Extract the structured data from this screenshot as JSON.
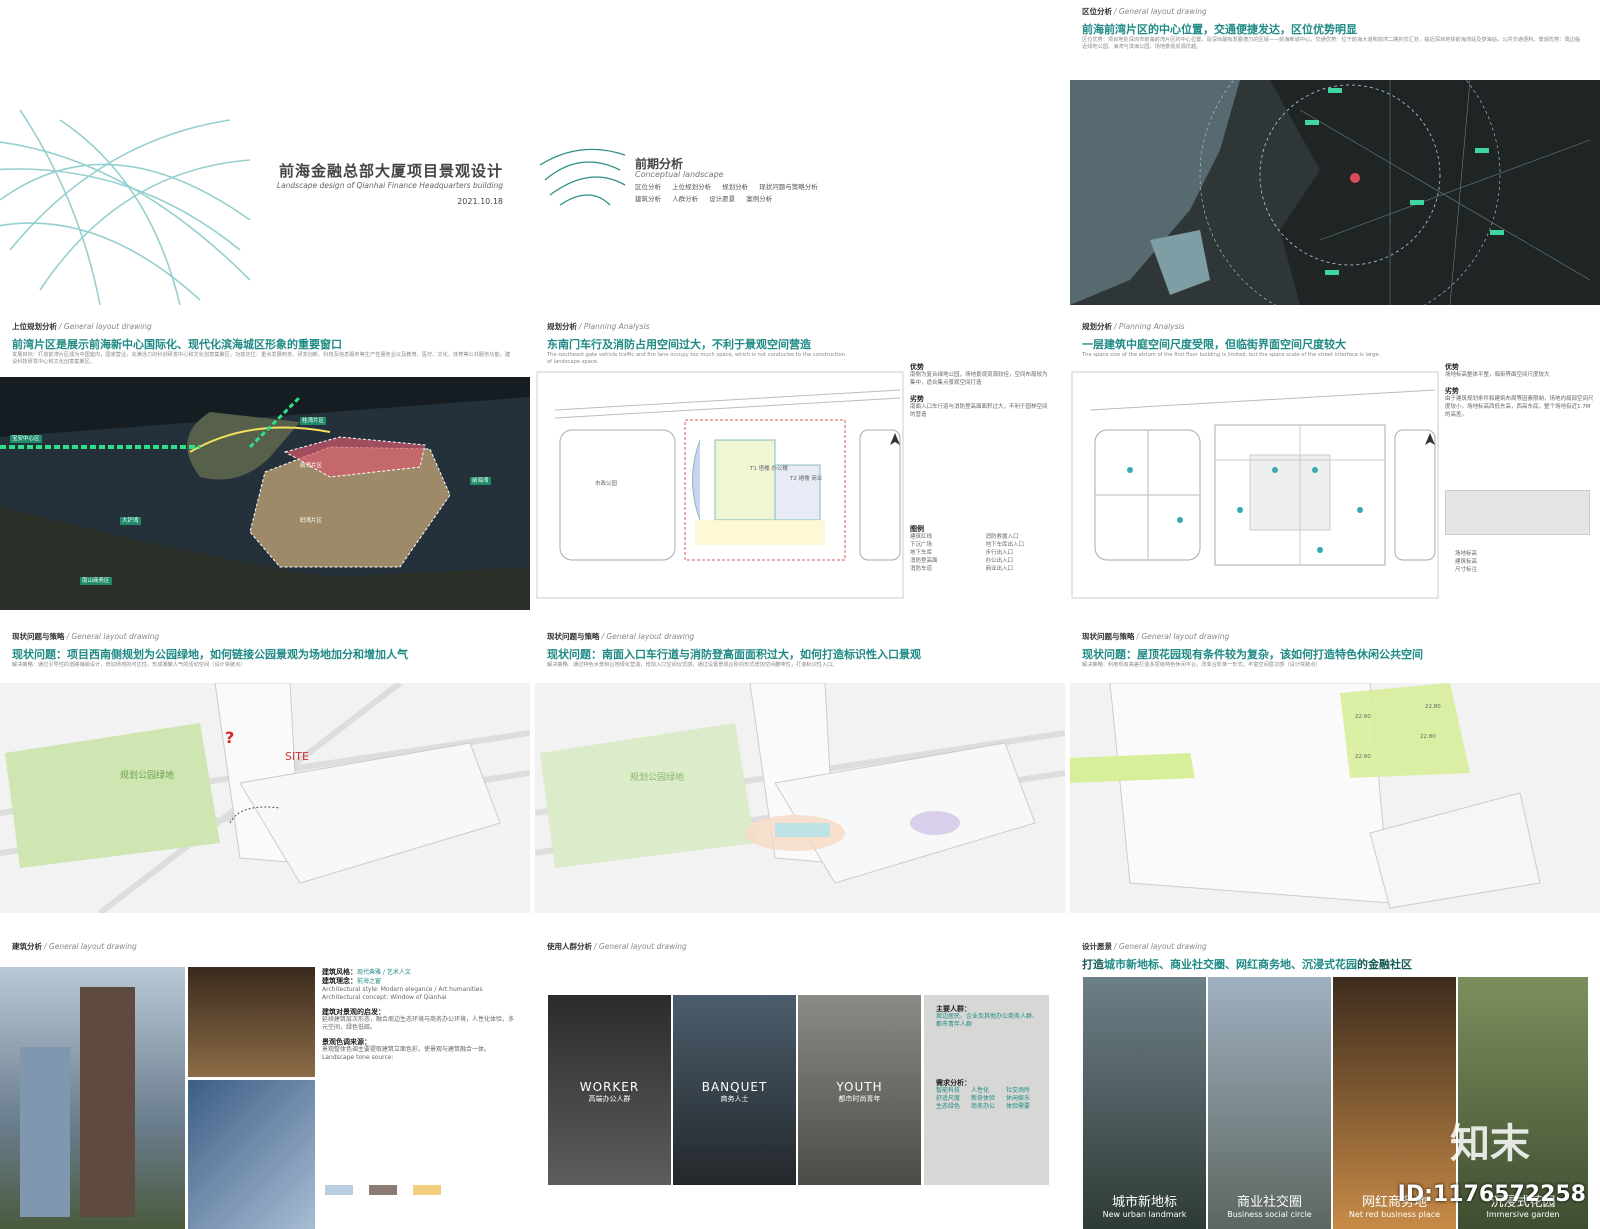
{
  "cover": {
    "title": "前海金融总部大厦项目景观设计",
    "subtitle": "Landscape design of Qianhai Finance Headquarters building",
    "date": "2021.10.18"
  },
  "concept": {
    "title": "前期分析",
    "subtitle": "Conceptual landscape",
    "menu": [
      "区位分析",
      "上位规划分析",
      "规划分析",
      "现状问题与策略分析",
      "建筑分析",
      "人群分析",
      "设计愿景",
      "案例分析"
    ]
  },
  "location": {
    "tag": "区位分析",
    "tag_en": "/ General layout drawing",
    "title": "前海前湾片区的中心位置，交通便捷发达，区位优势明显",
    "text": "区位优势：项目地处深圳市前海前湾片区的中心位置，是深圳最有发展潜力的区域——前海新城中心。交通优势：位于前海大道和前湾二路的交汇处，临近深圳地铁前海湾站及梦海站，公共交通便利。景观优势：周边临近绿地公园、海湾与滨海公园，场地景观资源优越。"
  },
  "upper_planning": {
    "tag": "上位规划分析",
    "tag_en": "/ General layout drawing",
    "title": "前湾片区是展示前海新中心国际化、现代化滨海城区形象的重要窗口",
    "text": "发展目标：打造前湾片区成为中国室内，国家营业，充满活力的科创研发中心和文化创意集聚区。功能定位：重点发展商务、研发创新、科技及信息服务等生产性服务业以及教育、医疗、文化、体育等公共服务功能，建设科技研发中心和文化创意集聚区。",
    "map_labels": [
      "前湾片区",
      "桂湾片区",
      "妈湾片区",
      "大铲湾",
      "前海湾",
      "宝安中心区",
      "南山商务区"
    ]
  },
  "planning_1": {
    "tag": "规划分析",
    "tag_en": "/ Planning Analysis",
    "title": "东南门车行及消防占用空间过大，不利于景观空间营造",
    "text": "The southeast gate vehicle traffic and fire lane occupy too much space, which is not conducive to the construction of landscape space.",
    "adv_h": "优势",
    "adv": "南侧为复合绿地公园，场地景观资源较佳，空间布局较为集中，适合集点景观空间打造",
    "dis_h": "劣势",
    "dis": "南面入口车行道与消防登高面面积过大，不利于园林空间的营造",
    "legend_h": "图例",
    "legend": [
      "建筑红线",
      "下沉广场",
      "地下车库",
      "消防登高面",
      "消防车道",
      "消防救援入口",
      "地下车库出入口",
      "步行出入口",
      "办公出入口",
      "商业出入口"
    ],
    "site_labels": [
      "T1 塔楼 办公楼",
      "T2 裙楼 商业",
      "市政公园"
    ]
  },
  "planning_2": {
    "tag": "规划分析",
    "tag_en": "/ Planning Analysis",
    "title": "一层建筑中庭空间尺度受限，但临街界面空间尺度较大",
    "text": "The space size of the atrium of the first floor building is limited, but the space scale of the street interface is large.",
    "adv_h": "优势",
    "adv": "场地标高整体平整，临街界面空间尺度较大",
    "dis_h": "劣势",
    "dis": "由于建筑规划条件和建筑布局等因素限制，场地内局部空间尺度较小。场地标高西低东高，西高东底，整个场地有近1.7M的高差。",
    "legend": [
      "场地标高",
      "建筑标高",
      "尺寸标注"
    ]
  },
  "issue_1": {
    "tag": "现状问题与策略",
    "tag_en": "/ General layout drawing",
    "title": "现状问题：项目西南侧规划为公园绿地，如何链接公园景观为场地加分和增加人气",
    "text": "解决策略：通过引导性的道路铺装设计，增加场地的可达性，形成凝聚人气的活动空间（设计突破点）",
    "park_label": "规划公园绿地",
    "site_label": "SITE",
    "question": "?"
  },
  "issue_2": {
    "tag": "现状问题与策略",
    "tag_en": "/ General layout drawing",
    "title": "现状问题：南面入口车行道与消防登高面面积过大，如何打造标识性入口景观",
    "text": "解决策略：通过特色水景和台地绿化营造，增加入口空间仪式感，通过设置景观台阶的形式增加空间趣味性，打造标识性入口。",
    "park_label": "规划公园绿地"
  },
  "issue_3": {
    "tag": "现状问题与策略",
    "tag_en": "/ General layout drawing",
    "title": "现状问题：屋顶花园现有条件较为复杂，该如何打造特色休闲公共空间",
    "text": "解决策略：利用现有高差打造多层级特色休闲平台，改变台阶单一形式，丰富空间层次感（设计突破点）",
    "levels": [
      "22.60",
      "22.80",
      "22.60",
      "22.80"
    ]
  },
  "architecture": {
    "tag": "建筑分析",
    "tag_en": "/ General layout drawing",
    "style_h": "建筑风格：",
    "style": "现代典雅 / 艺术人文",
    "concept_h": "建筑理念：",
    "concept": "前海之窗",
    "style_en": "Architectural style: Modern elegance / Art humanities",
    "concept_en": "Architectural concept: Window of Qianhai",
    "insp_h": "建筑对景观的启发：",
    "insp": "延续建筑层次形态，融合周边生态环境与商务办公环境，人性化体验，多元空间，绿色低碳。",
    "palette_h": "景观色调来源：",
    "palette": "景观整体色调主要提取建筑立面色彩，使景观与建筑融合一体。",
    "palette_en": "Landscape tone source:",
    "colors": [
      "#b9cde0",
      "#8c7b72",
      "#f1cf7e"
    ]
  },
  "users": {
    "tag": "使用人群分析",
    "tag_en": "/ General layout drawing",
    "groups": [
      {
        "en": "WORKER",
        "cn": "高端办公人群"
      },
      {
        "en": "BANQUET",
        "cn": "商务人士"
      },
      {
        "en": "YOUTH",
        "cn": "都市时尚青年"
      }
    ],
    "main_h": "主要人群：",
    "main": "周边居民、企业及其他办公商务人群、都市青年人群",
    "needs_h": "需求分析：",
    "needs": [
      "智能科技",
      "人性化",
      "社交场所",
      "舒适尺度",
      "新奇体验",
      "休闲娱乐",
      "生态绿色",
      "商务办公",
      "体验需要"
    ]
  },
  "vision": {
    "tag": "设计愿景",
    "tag_en": "/ General layout drawing",
    "title_a": "打造",
    "title_b": "城市新地标、商业社交圈、网红商务地、沉浸式花园",
    "title_c": "的金融社区",
    "items": [
      {
        "cn": "城市新地标",
        "en": "New urban landmark"
      },
      {
        "cn": "商业社交圈",
        "en": "Business social circle"
      },
      {
        "cn": "网红商务地",
        "en": "Net red business place"
      },
      {
        "cn": "沉浸式花园",
        "en": "Immersive garden"
      }
    ]
  },
  "watermark": {
    "logo": "知末",
    "id": "ID:1176572258"
  }
}
